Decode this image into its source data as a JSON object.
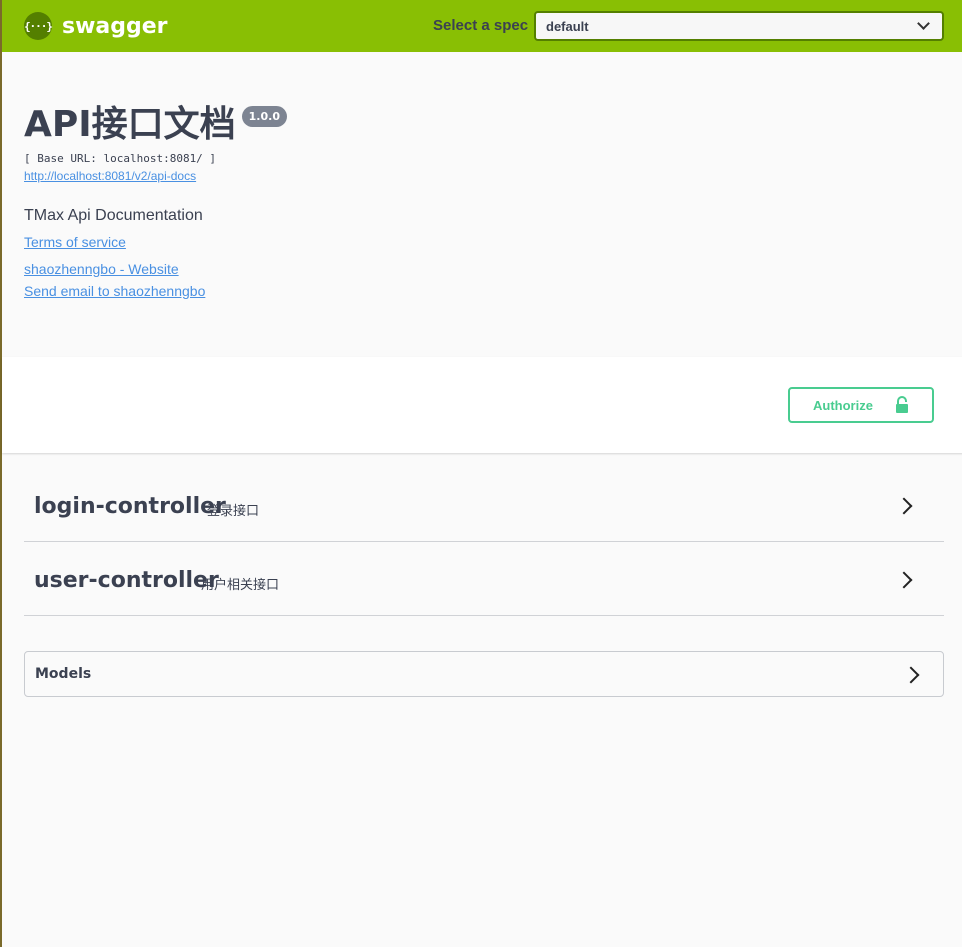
{
  "topbar": {
    "logo_glyph": "{···}",
    "logo_text": "swagger",
    "spec_label": "Select a spec",
    "spec_selected": "default",
    "colors": {
      "background": "#89bf04",
      "logo_badge": "#547f00"
    }
  },
  "info": {
    "title": "API接口文档",
    "version": "1.0.0",
    "base_url": "[ Base URL: localhost:8081/ ]",
    "api_docs_link": "http://localhost:8081/v2/api-docs",
    "description": "TMax Api Documentation",
    "terms_of_service": "Terms of service",
    "contact_website": "shaozhenngbo - Website",
    "contact_email": "Send email to shaozhenngbo"
  },
  "auth": {
    "authorize_label": "Authorize",
    "icon": "unlock-icon",
    "color": "#49cc90"
  },
  "tags": [
    {
      "name": "login-controller",
      "description": "登录接口",
      "icon": "chevron-right-icon"
    },
    {
      "name": "user-controller",
      "description": "用户相关接口",
      "icon": "chevron-right-icon"
    }
  ],
  "models": {
    "title": "Models",
    "icon": "chevron-right-icon"
  }
}
